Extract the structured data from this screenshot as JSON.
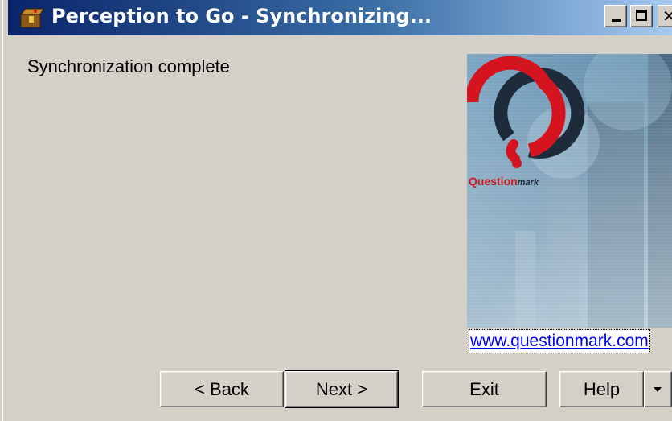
{
  "window": {
    "title": "Perception to Go - Synchronizing..."
  },
  "content": {
    "status_message": "Synchronization complete"
  },
  "banner": {
    "brand_prefix": "Question",
    "brand_suffix": "mark",
    "link_text": "www.questionmark.com",
    "colors": {
      "brand_red": "#d4141e",
      "ring_dark": "#1d2b3a"
    }
  },
  "buttons": {
    "back": "< Back",
    "next": "Next >",
    "exit": "Exit",
    "help": "Help"
  },
  "icons": {
    "app": "app-box-icon",
    "minimize": "minimize-icon",
    "maximize": "maximize-icon",
    "close": "close-icon",
    "dropdown": "chevron-down-icon"
  }
}
